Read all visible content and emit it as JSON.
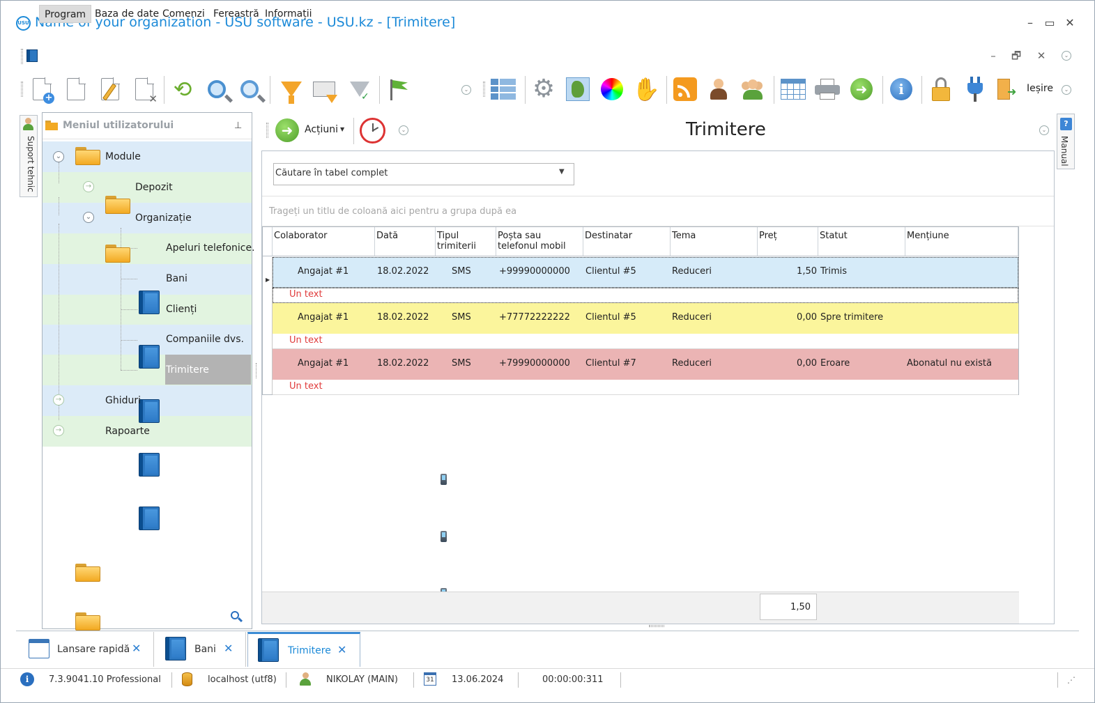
{
  "window": {
    "title": "Name of your organization - USU software - USU.kz - [Trimitere]",
    "logo_text": "USU"
  },
  "menubar": {
    "items": [
      "Program",
      "Baza de date",
      "Comenzi",
      "Fereastră",
      "Informații"
    ]
  },
  "toolbar": {
    "exit_label": "Ieșire"
  },
  "support_tab": {
    "label": "Suport tehnic"
  },
  "manual_tab": {
    "label": "Manual"
  },
  "nav": {
    "title": "Meniul utilizatorului",
    "items": [
      "Module",
      "Depozit",
      "Organizație",
      "Apeluri telefonice.",
      "Bani",
      "Clienți",
      "Companiile dvs.",
      "Trimitere",
      "Ghiduri",
      "Rapoarte"
    ]
  },
  "content": {
    "actions_label": "Acțiuni",
    "title": "Trimitere",
    "search_value": "Căutare în tabel complet",
    "group_hint": "Trageți un titlu de coloană aici pentru a grupa după ea"
  },
  "table": {
    "columns": [
      "Colaborator",
      "Dată",
      "Tipul trimiterii",
      "Poșta sau telefonul mobil",
      "Destinatar",
      "Tema",
      "Preț",
      "Statut",
      "Mențiune"
    ],
    "rows": [
      {
        "colaborator": "Angajat #1",
        "data": "18.02.2022",
        "tip": "SMS",
        "contact": "+99990000000",
        "destinatar": "Clientul #5",
        "tema": "Reduceri",
        "pret": "1,50",
        "statut": "Trimis",
        "mentiune": "",
        "note": "Un text",
        "color": "#d6ebf9"
      },
      {
        "colaborator": "Angajat #1",
        "data": "18.02.2022",
        "tip": "SMS",
        "contact": "+77772222222",
        "destinatar": "Clientul #5",
        "tema": "Reduceri",
        "pret": "0,00",
        "statut": "Spre trimitere",
        "mentiune": "",
        "note": "Un text",
        "color": "#fbf59c"
      },
      {
        "colaborator": "Angajat #1",
        "data": "18.02.2022",
        "tip": "SMS",
        "contact": "+79990000000",
        "destinatar": "Clientul #7",
        "tema": "Reduceri",
        "pret": "0,00",
        "statut": "Eroare",
        "mentiune": "Abonatul nu există",
        "note": "Un text",
        "color": "#ebb4b4"
      }
    ],
    "footer_sum": "1,50"
  },
  "tabs": [
    {
      "label": "Lansare rapidă"
    },
    {
      "label": "Bani"
    },
    {
      "label": "Trimitere"
    }
  ],
  "statusbar": {
    "version": "7.3.9041.10 Professional",
    "db": "localhost (utf8)",
    "user": "NIKOLAY (MAIN)",
    "calendar_day": "31",
    "date": "13.06.2024",
    "timer": "00:00:00:311"
  },
  "colors": {
    "accent": "#1c8ad8",
    "note_red": "#e03b3b",
    "nav_blue": "#dcebf8",
    "nav_green": "#e2f4e0"
  }
}
